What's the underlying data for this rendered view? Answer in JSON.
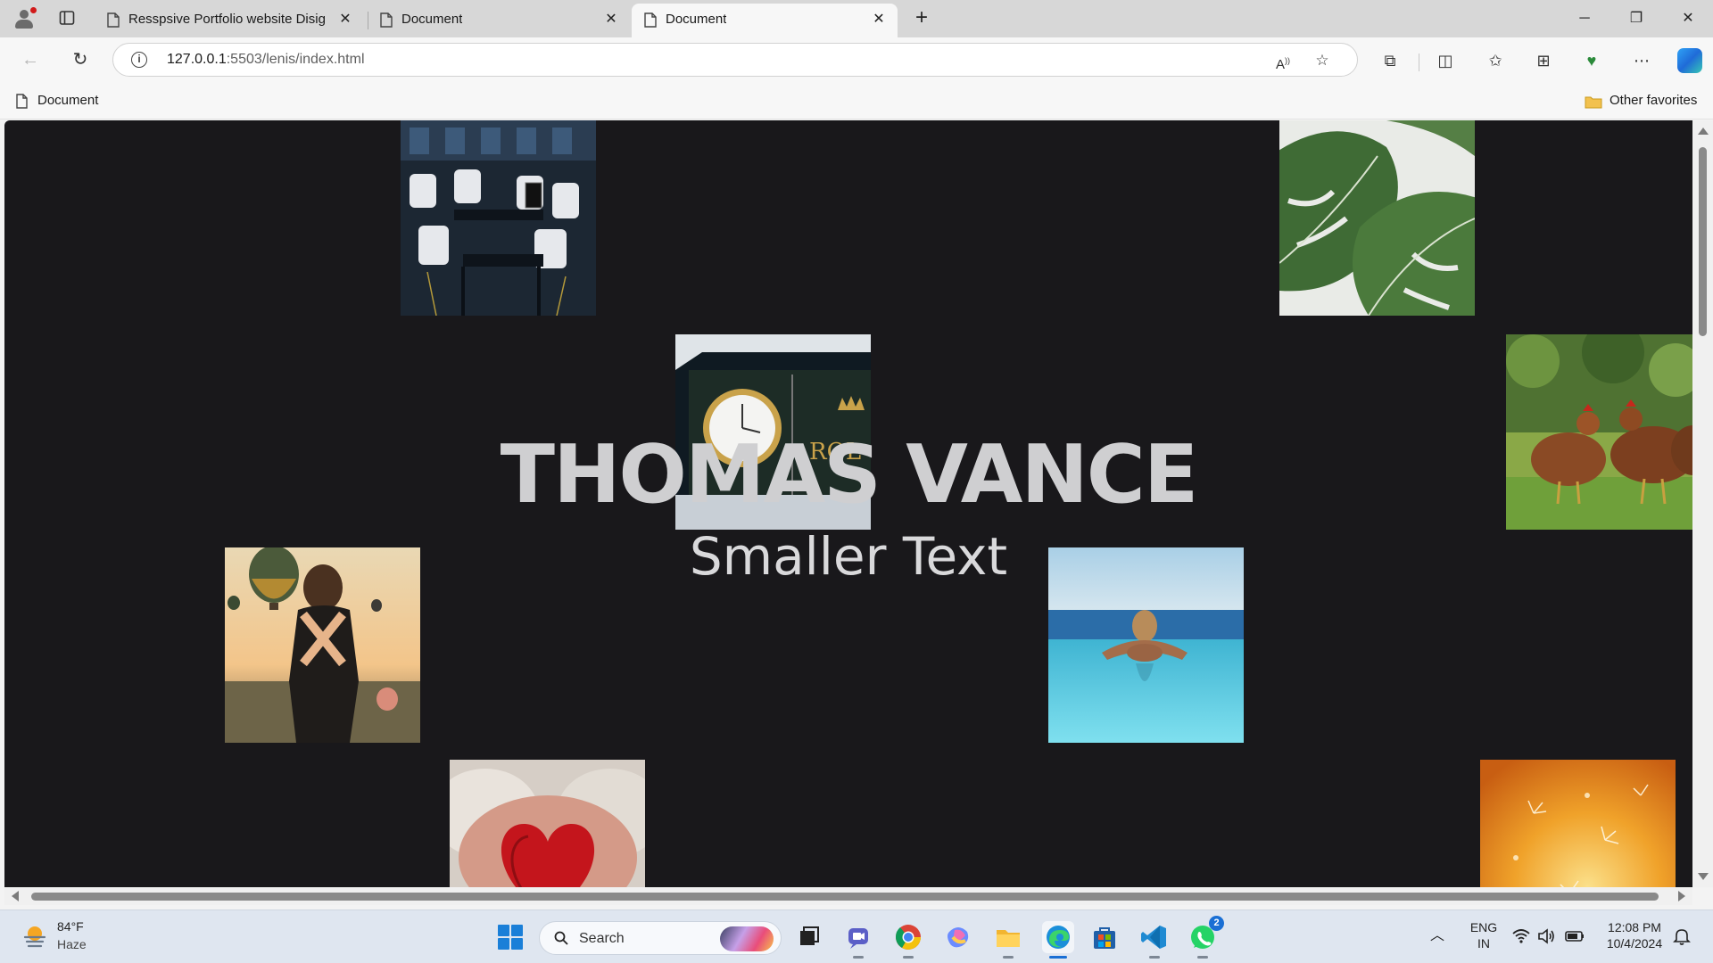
{
  "browser": {
    "tabs": [
      {
        "title": "Resspsive Portfolio website Disig",
        "active": false
      },
      {
        "title": "Document",
        "active": false
      },
      {
        "title": "Document",
        "active": true
      }
    ],
    "address": {
      "host": "127.0.0.1",
      "rest": ":5503/lenis/index.html"
    },
    "favorites": {
      "item": "Document",
      "other": "Other favorites"
    }
  },
  "page": {
    "title": "THOMAS VANCE",
    "subtitle": "Smaller Text",
    "background": "#19181b",
    "photos": [
      "restaurant-tables-photo",
      "monstera-leaves-photo",
      "rolex-clock-photo",
      "chickens-grass-photo",
      "balloons-woman-photo",
      "infinity-pool-photo",
      "knitted-heart-photo",
      "dandelion-golden-photo"
    ]
  },
  "taskbar": {
    "weather": {
      "temp": "84°F",
      "desc": "Haze"
    },
    "search": "Search",
    "language": {
      "line1": "ENG",
      "line2": "IN"
    },
    "clock": {
      "time": "12:08 PM",
      "date": "10/4/2024"
    },
    "whatsapp_badge": "2"
  },
  "colors": {
    "accent": "#1a6fd4",
    "tabstrip": "#d7d7d7",
    "taskbar": "#dfe6f0"
  }
}
